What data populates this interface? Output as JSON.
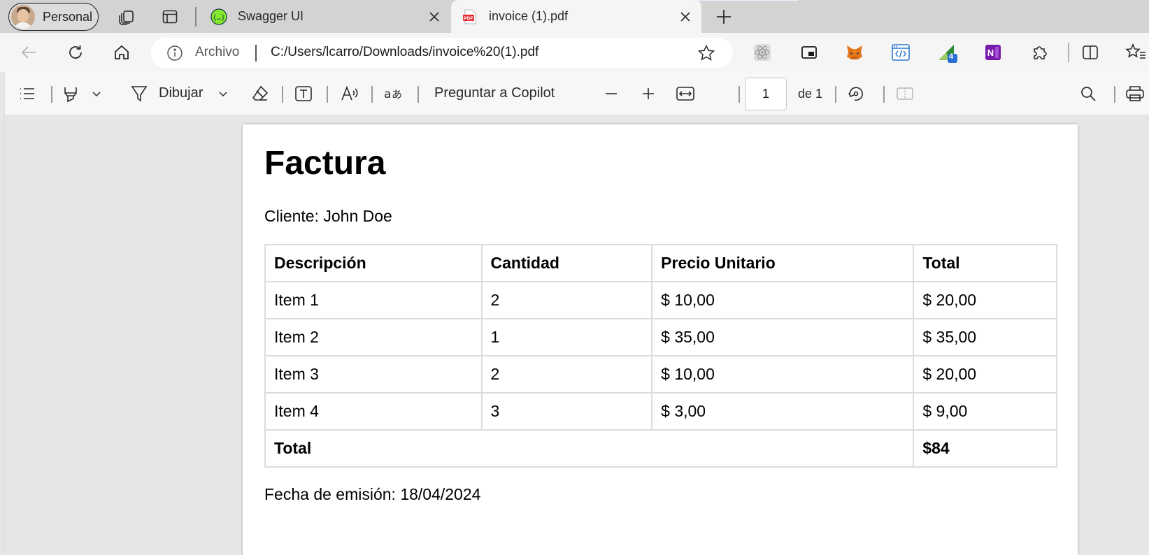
{
  "browser": {
    "profile_label": "Personal",
    "tabs": [
      {
        "title": "Swagger UI",
        "icon": "swagger-icon",
        "active": false
      },
      {
        "title": "invoice (1).pdf",
        "icon": "pdf-icon",
        "active": true
      }
    ],
    "address": {
      "scheme_label": "Archivo",
      "url": "C:/Users/lcarro/Downloads/invoice%20(1).pdf"
    },
    "extensions": [
      {
        "name": "react-devtools-icon"
      },
      {
        "name": "picture-in-picture-icon"
      },
      {
        "name": "metamask-fox-icon"
      },
      {
        "name": "web-developer-icon"
      },
      {
        "name": "green-extension-icon",
        "badge": "4"
      },
      {
        "name": "onenote-icon"
      },
      {
        "name": "extensions-puzzle-icon"
      }
    ],
    "accent_color": "#7b83eb"
  },
  "pdf_toolbar": {
    "draw_label": "Dibujar",
    "copilot_label": "Preguntar a Copilot",
    "page_current": "1",
    "page_total_label": "de 1"
  },
  "document": {
    "title": "Factura",
    "client": "Cliente: John Doe",
    "table": {
      "headers": [
        "Descripción",
        "Cantidad",
        "Precio Unitario",
        "Total"
      ],
      "rows": [
        [
          "Item 1",
          "2",
          "$ 10,00",
          "$ 20,00"
        ],
        [
          "Item 2",
          "1",
          "$ 35,00",
          "$ 35,00"
        ],
        [
          "Item 3",
          "2",
          "$ 10,00",
          "$ 20,00"
        ],
        [
          "Item 4",
          "3",
          "$ 3,00",
          "$ 9,00"
        ]
      ],
      "total_label": "Total",
      "total_value": "$84"
    },
    "issue_date": "Fecha de emisión: 18/04/2024"
  }
}
